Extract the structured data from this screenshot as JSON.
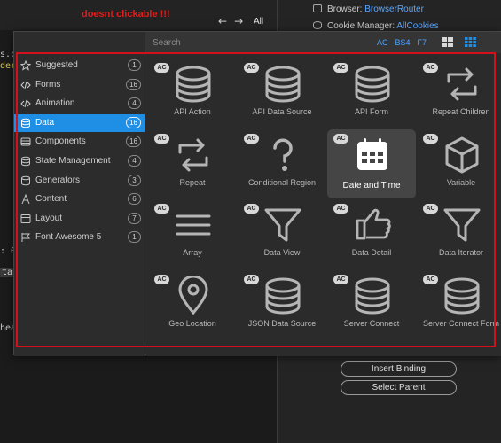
{
  "annotation": "doesnt clickable !!!",
  "background_editor": {
    "nav_back": "←",
    "nav_forward": "→",
    "nav_scope": "All",
    "code_fragments": [
      "s.co",
      "deri",
      ": 0",
      "tai",
      "hea"
    ]
  },
  "app_panel": {
    "rows": [
      {
        "label": "Browser: ",
        "value": "BrowserRouter",
        "icon": "browser-icon"
      },
      {
        "label": "Cookie Manager: ",
        "value": "AllCookies",
        "icon": "database-icon"
      }
    ],
    "buttons": [
      "Insert Binding",
      "Select Parent"
    ]
  },
  "picker": {
    "search_placeholder": "Search",
    "filters": [
      "AC",
      "BS4",
      "F7"
    ],
    "view_icons": [
      "large-grid-view-icon",
      "small-grid-view-icon",
      "list-view-icon"
    ],
    "categories": [
      {
        "label": "Suggested",
        "count": "1",
        "icon": "star-icon"
      },
      {
        "label": "Forms",
        "count": "16",
        "icon": "code-icon"
      },
      {
        "label": "Animation",
        "count": "4",
        "icon": "code-icon"
      },
      {
        "label": "Data",
        "count": "16",
        "icon": "database-icon",
        "active": true
      },
      {
        "label": "Components",
        "count": "16",
        "icon": "components-icon"
      },
      {
        "label": "State Management",
        "count": "4",
        "icon": "database-icon"
      },
      {
        "label": "Generators",
        "count": "3",
        "icon": "generators-icon"
      },
      {
        "label": "Content",
        "count": "6",
        "icon": "text-icon"
      },
      {
        "label": "Layout",
        "count": "7",
        "icon": "layout-icon"
      },
      {
        "label": "Font Awesome 5",
        "count": "1",
        "icon": "flag-icon"
      }
    ],
    "items": [
      {
        "label": "API Action",
        "badge": "AC",
        "icon": "database"
      },
      {
        "label": "API Data Source",
        "badge": "AC",
        "icon": "database"
      },
      {
        "label": "API Form",
        "badge": "AC",
        "icon": "database"
      },
      {
        "label": "Repeat Children",
        "badge": "AC",
        "icon": "repeat"
      },
      {
        "label": "Repeat",
        "badge": "AC",
        "icon": "repeat"
      },
      {
        "label": "Conditional Region",
        "badge": "AC",
        "icon": "question"
      },
      {
        "label": "Date and Time",
        "badge": "AC",
        "icon": "calendar",
        "selected": true
      },
      {
        "label": "Variable",
        "badge": "AC",
        "icon": "cube"
      },
      {
        "label": "Array",
        "badge": "AC",
        "icon": "bars"
      },
      {
        "label": "Data View",
        "badge": "AC",
        "icon": "filter"
      },
      {
        "label": "Data Detail",
        "badge": "AC",
        "icon": "hand-point"
      },
      {
        "label": "Data Iterator",
        "badge": "AC",
        "icon": "filter"
      },
      {
        "label": "Geo Location",
        "badge": "AC",
        "icon": "map-marker"
      },
      {
        "label": "JSON Data Source",
        "badge": "AC",
        "icon": "database"
      },
      {
        "label": "Server Connect",
        "badge": "AC",
        "icon": "database"
      },
      {
        "label": "Server Connect Form",
        "badge": "AC",
        "icon": "database"
      }
    ]
  },
  "colors": {
    "accent": "#1f8fe6",
    "filter_text": "#4ea3ff",
    "annotation": "#e01e1e",
    "highlight_box": "#d3101c"
  }
}
